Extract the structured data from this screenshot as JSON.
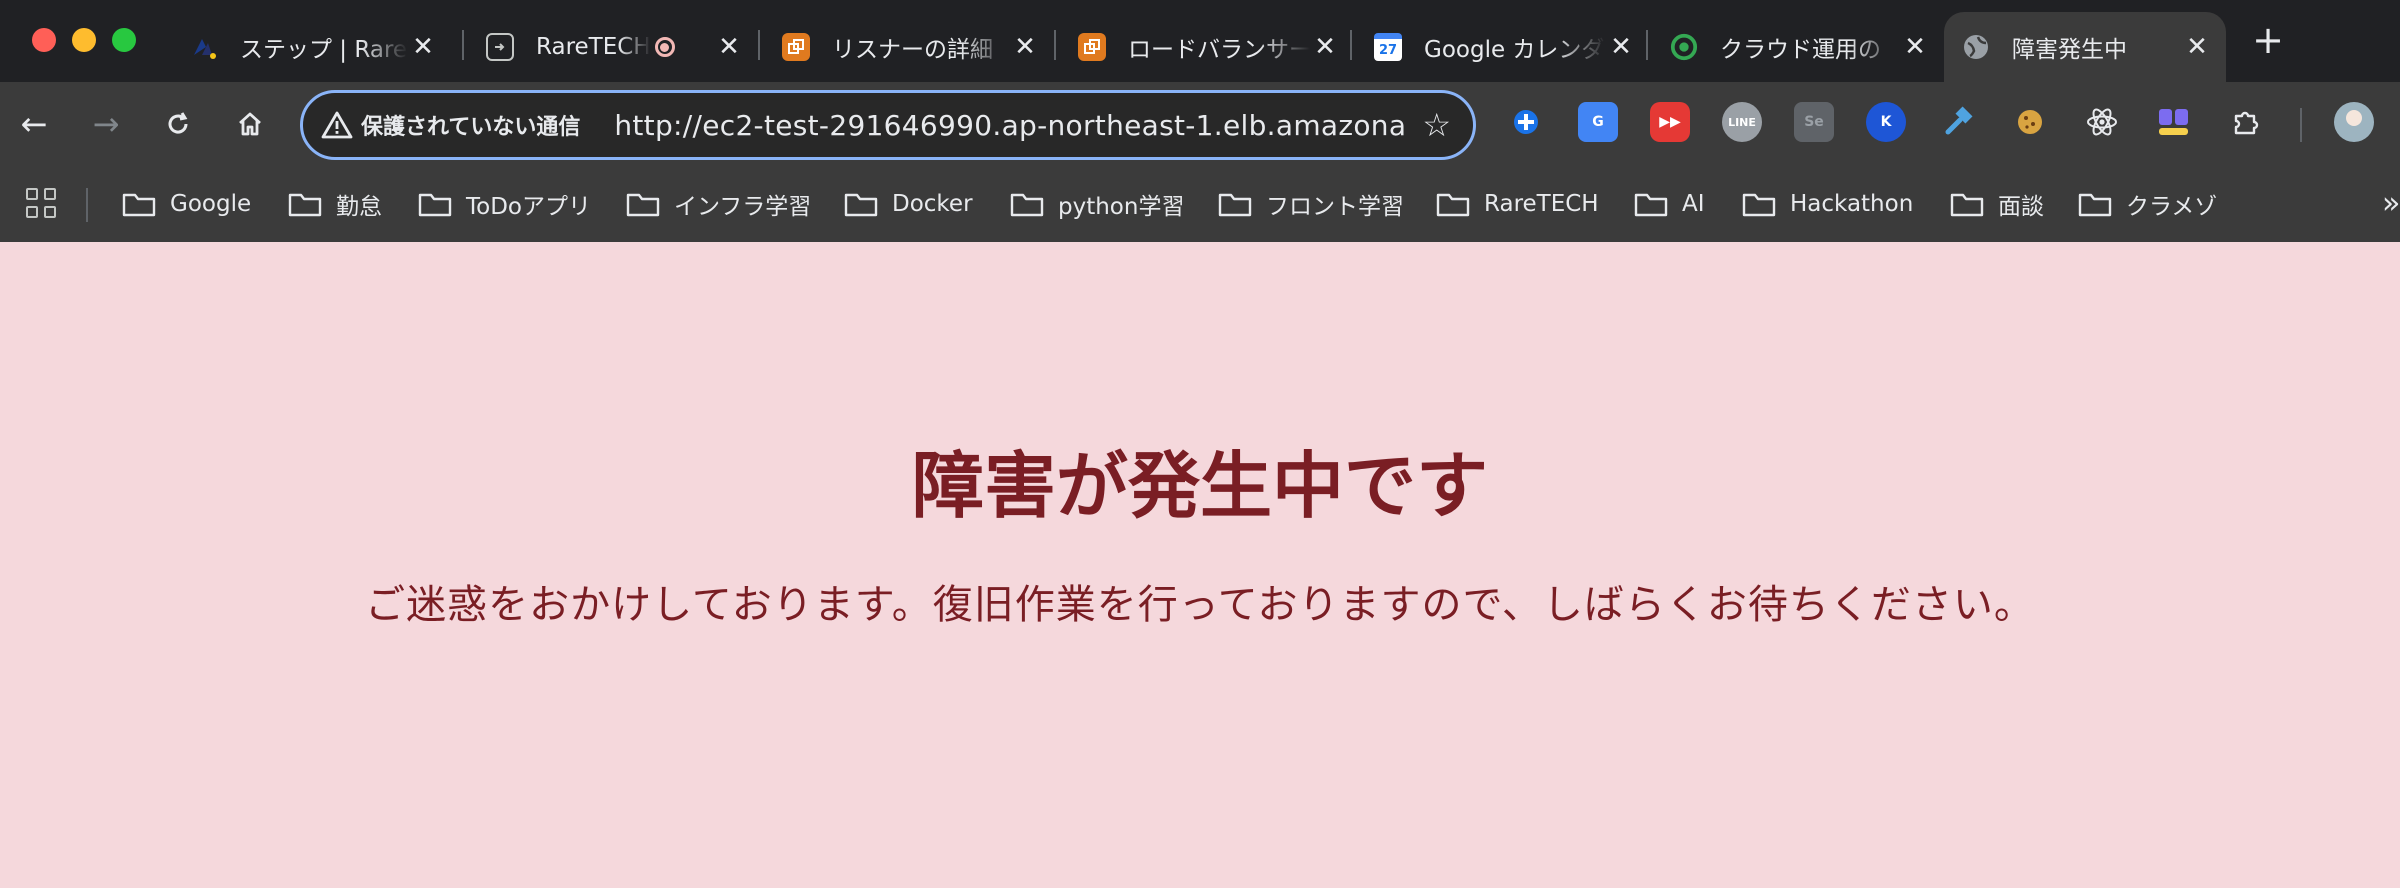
{
  "tabs": [
    {
      "title": "ステップ | RareTECH",
      "icon": "raretech-logo-icon"
    },
    {
      "title": "RareTECH",
      "icon": "screen-share-icon",
      "recording": true
    },
    {
      "title": "リスナーの詳細",
      "icon": "aws-ec2-icon"
    },
    {
      "title": "ロードバランサー",
      "icon": "aws-ec2-icon"
    },
    {
      "title": "Google カレンダー",
      "icon": "google-calendar-icon",
      "icon_text": "27"
    },
    {
      "title": "クラウド運用の",
      "icon": "green-swirl-icon"
    },
    {
      "title": "障害発生中",
      "icon": "globe-icon",
      "active": true
    }
  ],
  "toolbar": {
    "security_label": "保護されていない通信",
    "url": "http://ec2-test-291646990.ap-northeast-1.elb.amazona..."
  },
  "extensions": [
    {
      "name": "puzzle-blue-icon",
      "color": "#1a73e8"
    },
    {
      "name": "google-translate-icon",
      "color": "#4285f4"
    },
    {
      "name": "youtube-icon",
      "color": "#e53935"
    },
    {
      "name": "line-icon",
      "color": "#9aa0a6"
    },
    {
      "name": "selenium-icon",
      "color": "#5f6368"
    },
    {
      "name": "kde-icon",
      "color": "#1e56d6"
    },
    {
      "name": "hammer-icon",
      "color": "#4fa3e0"
    },
    {
      "name": "cookie-icon",
      "color": "#d9a441"
    },
    {
      "name": "react-icon",
      "color": "#e8eaed"
    },
    {
      "name": "profiles-icon",
      "color": "#7c6cf0"
    },
    {
      "name": "extensions-puzzle-icon",
      "color": "#e8eaed"
    }
  ],
  "bookmarks": [
    "Google",
    "勤怠",
    "ToDoアプリ",
    "インフラ学習",
    "Docker",
    "python学習",
    "フロント学習",
    "RareTECH",
    "AI",
    "Hackathon",
    "面談",
    "クラメゾ"
  ],
  "page": {
    "title": "障害が発生中です",
    "message": "ご迷惑をおかけしております。復旧作業を行っておりますので、しばらくお待ちください。"
  },
  "colors": {
    "page_background": "#f5d8dc",
    "text_dark_red": "#7a1e24",
    "omnibox_focus": "#8ab4f8"
  }
}
